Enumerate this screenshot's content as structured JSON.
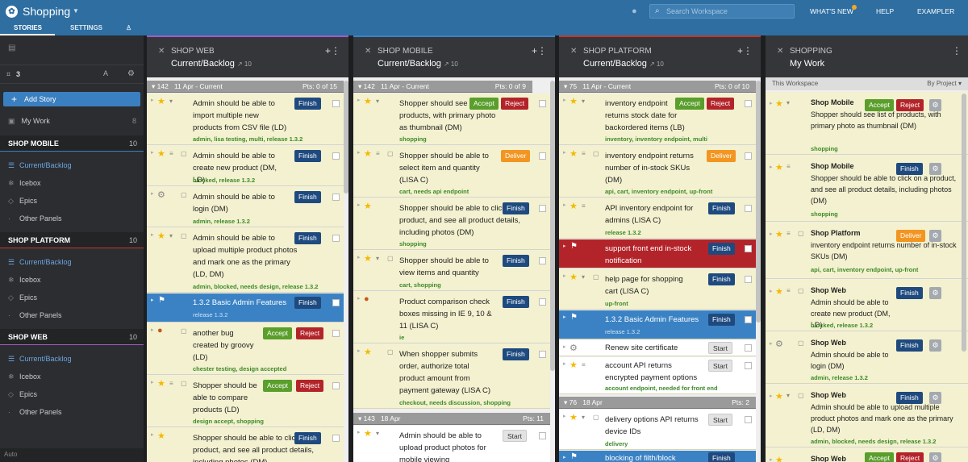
{
  "app": {
    "title": "Shopping"
  },
  "search": {
    "placeholder": "Search Workspace"
  },
  "topnav": {
    "whats_new": "WHAT'S NEW",
    "help": "HELP",
    "user": "EXAMPLER"
  },
  "tabs": {
    "stories": "STORIES",
    "settings": "SETTINGS"
  },
  "sidebar": {
    "count": "3",
    "add_story": "Add Story",
    "my_work": "My Work",
    "my_work_count": "8",
    "sections": [
      {
        "name": "SHOP MOBILE",
        "count": "10",
        "items": [
          "Current/Backlog",
          "Icebox",
          "Epics",
          "Other Panels"
        ]
      },
      {
        "name": "SHOP PLATFORM",
        "count": "10",
        "items": [
          "Current/Backlog",
          "Icebox",
          "Epics",
          "Other Panels"
        ]
      },
      {
        "name": "SHOP WEB",
        "count": "10",
        "items": [
          "Current/Backlog",
          "Icebox",
          "Epics",
          "Other Panels"
        ]
      }
    ],
    "bottom": "Auto"
  },
  "colors": {
    "web": "#a05bc8",
    "mobile": "#3a82c4",
    "platform": "#c0392b",
    "accent": "#2e6ea1"
  },
  "panels": {
    "web": {
      "name": "SHOP WEB",
      "view": "Current/Backlog",
      "count": "10",
      "iter": {
        "num": "142",
        "date": "11 Apr - Current",
        "pts": "Pts: 0 of 15"
      },
      "stories": [
        {
          "title": "Admin should be able to import multiple new products from CSV file (LD)",
          "labels": "admin, lisa testing, multi, release 1.3.2",
          "btn": "Finish"
        },
        {
          "title": "Admin should be able to create new product (DM, LD)",
          "labels": "blocked, release 1.3.2",
          "btn": "Finish"
        },
        {
          "title": "Admin should be able to login (DM)",
          "labels": "admin, release 1.3.2",
          "btn": "Finish"
        },
        {
          "title": "Admin should be able to upload multiple product photos and mark one as the primary (LD, DM)",
          "labels": "admin, blocked, needs design, release 1.3.2",
          "btn": "Finish"
        },
        {
          "title": "1.3.2 Basic Admin Features",
          "labels": "release 1.3.2",
          "btn": "Finish"
        },
        {
          "title": "another bug created by groovy (LD)",
          "labels": "chester testing, design accepted",
          "btn": "Accept",
          "btn2": "Reject"
        },
        {
          "title": "Shopper should be able to compare products (LD)",
          "labels": "design accept, shopping",
          "btn": "Accept",
          "btn2": "Reject"
        },
        {
          "title": "Shopper should be able to click on a product, and see all product details, including photos (DM)",
          "labels": "",
          "btn": "Finish"
        }
      ]
    },
    "mobile": {
      "name": "SHOP MOBILE",
      "view": "Current/Backlog",
      "count": "10",
      "iter": {
        "num": "142",
        "date": "11 Apr - Current",
        "pts": "Pts: 0 of 9"
      },
      "iter2": {
        "num": "143",
        "date": "18 Apr",
        "pts": "Pts: 11"
      },
      "stories": [
        {
          "title": "Shopper should see list of products, with primary photo as thumbnail (DM)",
          "labels": "shopping",
          "btn": "Accept",
          "btn2": "Reject"
        },
        {
          "title": "Shopper should be able to select item and quantity (LISA C)",
          "labels": "cart, needs api endpoint",
          "btn": "Deliver"
        },
        {
          "title": "Shopper should be able to click on a product, and see all product details, including photos (DM)",
          "labels": "shopping",
          "btn": "Finish"
        },
        {
          "title": "Shopper should be able to view items and quantity",
          "labels": "cart, shopping",
          "btn": "Finish"
        },
        {
          "title": "Product comparison check boxes missing in IE 9, 10 & 11 (LISA C)",
          "labels": "ie",
          "btn": "Finish"
        },
        {
          "title": "When shopper submits order, authorize total product amount from payment gateway (LISA C)",
          "labels": "checkout, needs discussion, shopping",
          "btn": "Finish"
        },
        {
          "title": "Admin should be able to upload product photos for mobile viewing",
          "labels": "",
          "btn": "Start"
        }
      ]
    },
    "platform": {
      "name": "SHOP PLATFORM",
      "view": "Current/Backlog",
      "count": "10",
      "iter": {
        "num": "75",
        "date": "11 Apr - Current",
        "pts": "Pts: 0 of 10"
      },
      "iter2": {
        "num": "76",
        "date": "18 Apr",
        "pts": "Pts: 2"
      },
      "stories": [
        {
          "title": "inventory endpoint returns stock date for backordered items (LB)",
          "labels": "inventory, inventory endpoint, multi",
          "btn": "Accept",
          "btn2": "Reject"
        },
        {
          "title": "inventory endpoint returns number of in-stock SKUs (DM)",
          "labels": "api, cart, inventory endpoint, up-front",
          "btn": "Deliver"
        },
        {
          "title": "API inventory endpoint for admins (LISA C)",
          "labels": "release 1.3.2",
          "btn": "Finish"
        },
        {
          "title": "support front end in-stock notification",
          "labels": "",
          "btn": "Finish"
        },
        {
          "title": "help page for shopping cart (LISA C)",
          "labels": "up-front",
          "btn": "Finish"
        },
        {
          "title": "1.3.2 Basic Admin Features",
          "labels": "release 1.3.2",
          "btn": "Finish"
        },
        {
          "title": "Renew site certificate",
          "labels": "",
          "btn": "Start"
        },
        {
          "title": "account API returns encrypted payment options",
          "labels": "account endpoint, needed for front end",
          "btn": "Start"
        },
        {
          "title": "delivery options API returns device IDs",
          "labels": "delivery",
          "btn": "Start"
        },
        {
          "title": "blocking of filth/block",
          "labels": "",
          "btn": "Finish"
        }
      ]
    },
    "shopping": {
      "name": "SHOPPING",
      "view": "My Work",
      "ws_label": "This Workspace",
      "ws_by": "By Project",
      "stories": [
        {
          "project": "Shop Mobile",
          "title": "Shopper should see list of products, with primary photo as thumbnail (DM)",
          "labels": "shopping",
          "btn": "Accept",
          "btn2": "Reject"
        },
        {
          "project": "Shop Mobile",
          "title": "Shopper should be able to click on a product, and see all product details, including photos (DM)",
          "labels": "shopping",
          "btn": "Finish"
        },
        {
          "project": "Shop Platform",
          "title": "inventory endpoint returns number of in-stock SKUs (DM)",
          "labels": "api, cart, inventory endpoint, up-front",
          "btn": "Deliver"
        },
        {
          "project": "Shop Web",
          "title": "Admin should be able to create new product (DM, LD)",
          "labels": "blocked, release 1.3.2",
          "btn": "Finish"
        },
        {
          "project": "Shop Web",
          "title": "Admin should be able to login (DM)",
          "labels": "admin, release 1.3.2",
          "btn": "Finish"
        },
        {
          "project": "Shop Web",
          "title": "Admin should be able to upload multiple product photos and mark one as the primary (LD, DM)",
          "labels": "admin, blocked, needs design, release 1.3.2",
          "btn": "Finish"
        },
        {
          "project": "Shop Web",
          "title": "",
          "labels": "",
          "btn": "Accept",
          "btn2": "Reject"
        }
      ]
    }
  }
}
